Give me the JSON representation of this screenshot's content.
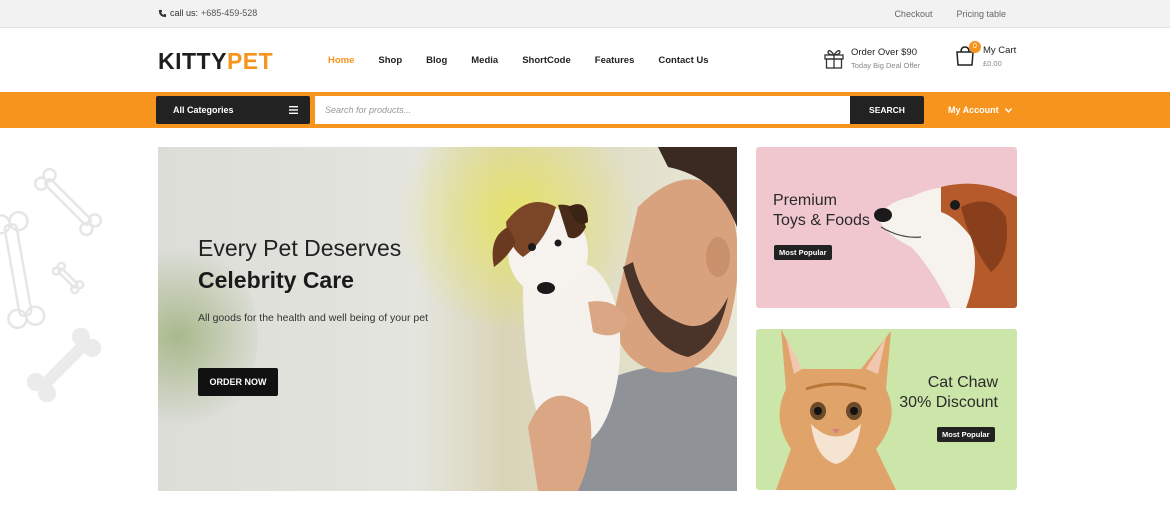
{
  "topbar": {
    "call_label": "call us:",
    "phone": "+685-459-528",
    "links": [
      "Checkout",
      "Pricing table"
    ]
  },
  "logo": {
    "part1": "KITTY",
    "part2": "PET"
  },
  "nav": [
    "Home",
    "Shop",
    "Blog",
    "Media",
    "ShortCode",
    "Features",
    "Contact Us"
  ],
  "offer": {
    "line1": "Order Over $90",
    "line2": "Today Big Deal Offer"
  },
  "cart": {
    "count": "0",
    "label": "My Cart",
    "amount": "£0.00"
  },
  "searchbar": {
    "categories_label": "All Categories",
    "placeholder": "Search for products...",
    "search_button": "SEARCH",
    "account_label": "My Account"
  },
  "hero": {
    "title_line1": "Every Pet Deserves",
    "title_line2": "Celebrity Care",
    "subtitle": "All goods for the health and well being of your pet",
    "button": "ORDER NOW"
  },
  "promos": [
    {
      "title_line1": "Premium",
      "title_line2": "Toys & Foods",
      "tag": "Most Popular"
    },
    {
      "title_line1": "Cat Chaw",
      "title_line2": "30% Discount",
      "tag": "Most Popular"
    }
  ],
  "colors": {
    "accent": "#f7941d",
    "dark": "#222222",
    "pink_card": "#f0c7cf",
    "green_card": "#cce5a9"
  }
}
